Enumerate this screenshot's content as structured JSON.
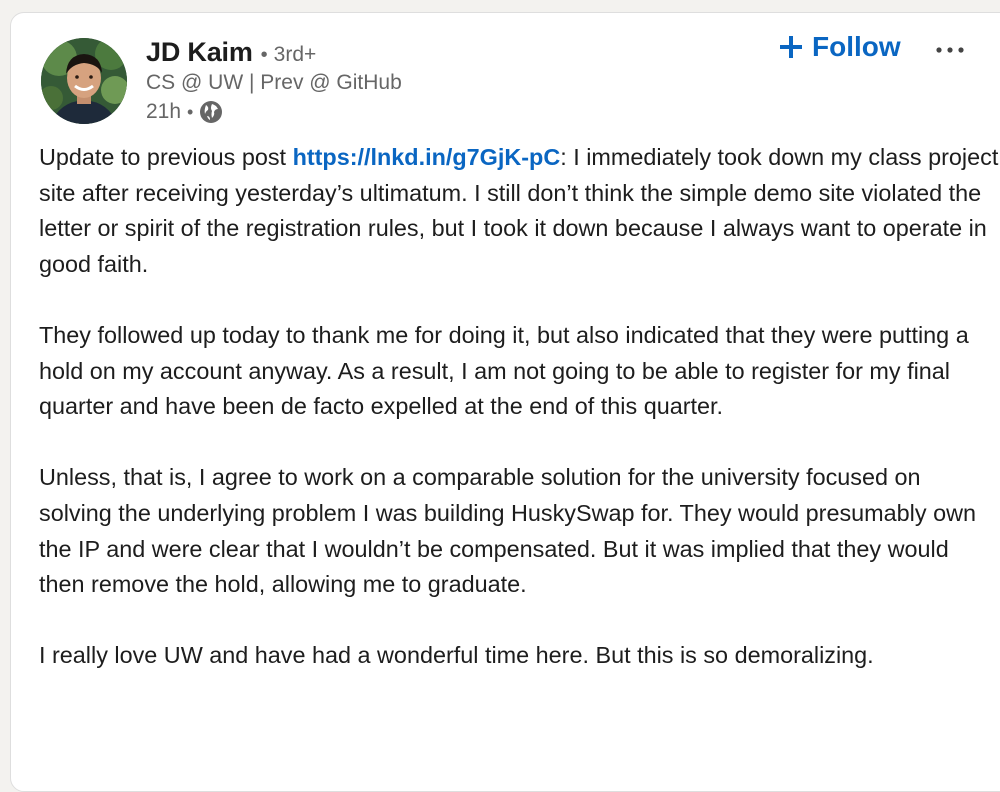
{
  "author": {
    "name": "JD Kaim",
    "degree": "3rd+",
    "headline": "CS @ UW | Prev @ GitHub",
    "time_ago": "21h",
    "visibility_icon": "globe-icon",
    "avatar_icon": "avatar-photo"
  },
  "actions": {
    "follow_label": "Follow",
    "follow_icon": "plus-icon",
    "more_icon": "more-horizontal-icon"
  },
  "post": {
    "p1_before_link": "Update to previous post ",
    "p1_link": "https://lnkd.in/g7GjK-pC",
    "p1_after_link": ": I immediately took down my class project site after receiving yesterday’s ultimatum. I still don’t think the simple demo site violated the letter or spirit of the registration rules, but I took it down because I always want to operate in good faith.",
    "p2": "They followed up today to thank me for doing it, but also indicated that they were putting a hold on my account anyway. As a result, I am not going to be able to register for my final quarter and have been de facto expelled at the end of this quarter.",
    "p3": "Unless, that is, I agree to work on a comparable solution for the university focused on solving the underlying problem I was building HuskySwap for. They would presumably own the IP and were clear that I wouldn’t be compensated. But it was implied that they would then remove the hold, allowing me to graduate.",
    "p4": "I really love UW and have had a wonderful time here. But this is so demoralizing."
  },
  "colors": {
    "accent": "#0a66c2",
    "text": "#1d1d1d",
    "muted": "#666666"
  }
}
